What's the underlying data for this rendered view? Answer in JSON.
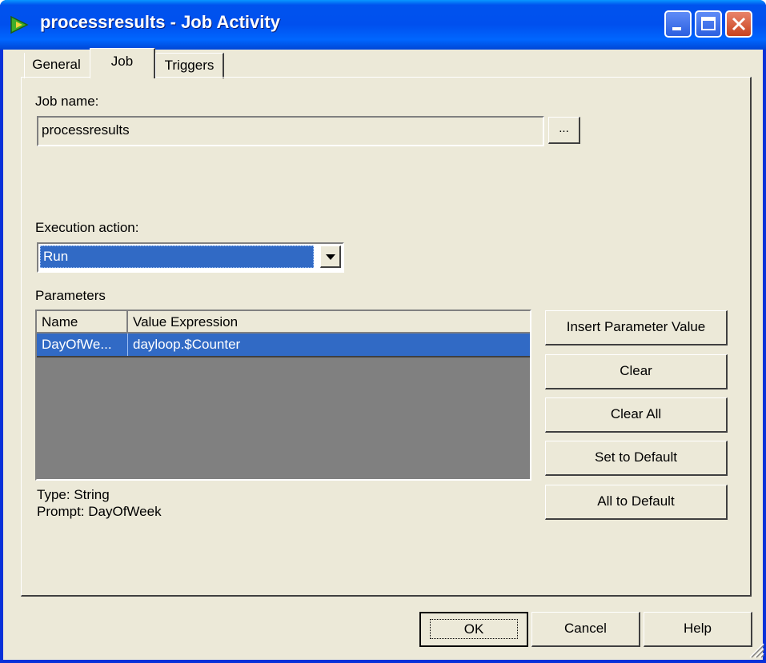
{
  "window": {
    "title": "processresults - Job Activity"
  },
  "tabs": [
    {
      "label": "General"
    },
    {
      "label": "Job"
    },
    {
      "label": "Triggers"
    }
  ],
  "job_name": {
    "label": "Job name:",
    "value": "processresults",
    "browse_label": "..."
  },
  "execution_action": {
    "label": "Execution action:",
    "value": "Run"
  },
  "parameters": {
    "label": "Parameters",
    "columns": [
      "Name",
      "Value Expression"
    ],
    "rows": [
      {
        "name": "DayOfWe...",
        "value": "dayloop.$Counter"
      }
    ],
    "type_text": "Type: String",
    "prompt_text": "Prompt: DayOfWeek"
  },
  "side_buttons": {
    "insert": "Insert Parameter Value",
    "clear": "Clear",
    "clear_all": "Clear All",
    "set_default": "Set to Default",
    "all_default": "All to Default"
  },
  "footer": {
    "ok": "OK",
    "cancel": "Cancel",
    "help": "Help"
  },
  "colors": {
    "title_bar": "#0055e5",
    "selection": "#316ac5",
    "dialog_bg": "#ece9d8"
  }
}
